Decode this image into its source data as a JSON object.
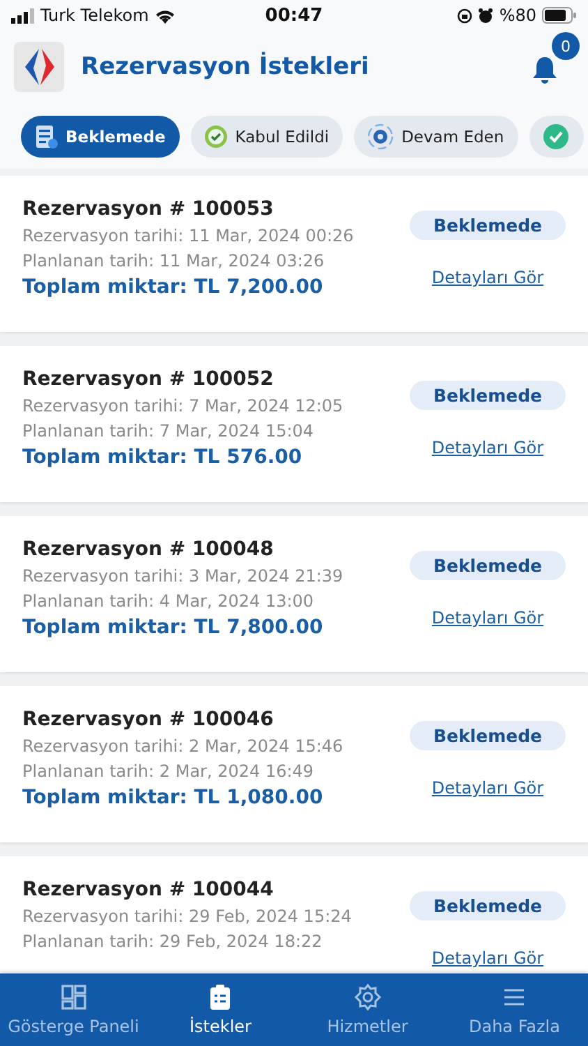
{
  "status_bar": {
    "carrier": "Turk Telekom",
    "time": "00:47",
    "battery": "%80"
  },
  "header": {
    "title": "Rezervasyon İstekleri",
    "notification_count": "0"
  },
  "filters": [
    {
      "label": "Beklemede",
      "kind": "pending",
      "selected": true
    },
    {
      "label": "Kabul Edildi",
      "kind": "accepted",
      "selected": false
    },
    {
      "label": "Devam Eden",
      "kind": "ongoing",
      "selected": false
    },
    {
      "kind": "done",
      "selected": false
    }
  ],
  "reservations": [
    {
      "title": "Rezervasyon # 100053",
      "created": "Rezervasyon tarihi:  11 Mar, 2024 00:26",
      "planned": "Planlanan tarih: 11 Mar, 2024 03:26",
      "total": "Toplam miktar: TL 7,200.00",
      "status": "Beklemede",
      "link": "Detayları Gör"
    },
    {
      "title": "Rezervasyon # 100052",
      "created": "Rezervasyon tarihi:  7 Mar, 2024 12:05",
      "planned": "Planlanan tarih: 7 Mar, 2024 15:04",
      "total": "Toplam miktar: TL 576.00",
      "status": "Beklemede",
      "link": "Detayları Gör"
    },
    {
      "title": "Rezervasyon # 100048",
      "created": "Rezervasyon tarihi:  3 Mar, 2024 21:39",
      "planned": "Planlanan tarih: 4 Mar, 2024 13:00",
      "total": "Toplam miktar: TL 7,800.00",
      "status": "Beklemede",
      "link": "Detayları Gör"
    },
    {
      "title": "Rezervasyon # 100046",
      "created": "Rezervasyon tarihi:  2 Mar, 2024 15:46",
      "planned": "Planlanan tarih: 2 Mar, 2024 16:49",
      "total": "Toplam miktar: TL 1,080.00",
      "status": "Beklemede",
      "link": "Detayları Gör"
    },
    {
      "title": "Rezervasyon # 100044",
      "created": "Rezervasyon tarihi:  29 Feb, 2024 15:24",
      "planned": "Planlanan tarih: 29 Feb, 2024 18:22",
      "status": "Beklemede",
      "link": "Detayları Gör"
    }
  ],
  "tab_bar": [
    {
      "label": "Gösterge Paneli",
      "kind": "dashboard",
      "selected": false
    },
    {
      "label": "İstekler",
      "kind": "requests",
      "selected": true
    },
    {
      "label": "Hizmetler",
      "kind": "services",
      "selected": false
    },
    {
      "label": "Daha Fazla",
      "kind": "more",
      "selected": false
    }
  ]
}
